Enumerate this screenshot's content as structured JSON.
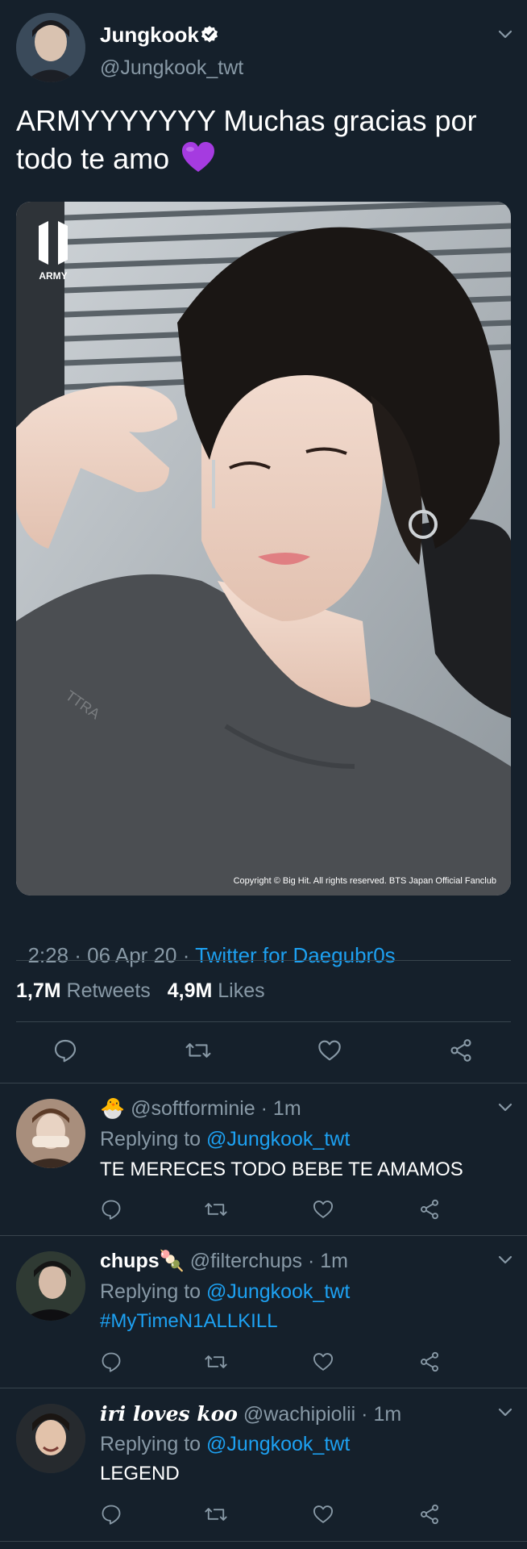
{
  "tweet": {
    "display_name": "Jungkook",
    "handle": "@Jungkook_twt",
    "text": "ARMYYYYYYY Muchas gracias por todo te amo",
    "emoji": "💜",
    "photo": {
      "logo_text": "ARMY",
      "shirt_text": "TTRA",
      "copyright": "Copyright © Big Hit. All rights reserved. BTS Japan Official Fanclub"
    },
    "time_date": "2:28 · 06 Apr 20 · ",
    "source": "Twitter for Daegubr0s",
    "retweets_count": "1,7M",
    "retweets_label": "Retweets",
    "likes_count": "4,9M",
    "likes_label": "Likes"
  },
  "replies": [
    {
      "display_name": "",
      "emoji": "🐣",
      "handle": "@softforminie",
      "time": "· 1m",
      "replying_prefix": "Replying to",
      "replying_to": "@Jungkook_twt",
      "text": "TE MERECES TODO BEBE TE AMAMOS"
    },
    {
      "display_name": "chups",
      "emoji": "🍡",
      "handle": "@filterchups",
      "time": "· 1m",
      "replying_prefix": "Replying to",
      "replying_to": "@Jungkook_twt",
      "text": "#MyTimeN1ALLKILL"
    },
    {
      "display_name": "iri loves koo",
      "emoji": "",
      "handle": "@wachipiolii",
      "time": "· 1m",
      "replying_prefix": "Replying to",
      "replying_to": "@Jungkook_twt",
      "text": "LEGEND"
    }
  ],
  "icons": [
    "verified-badge-icon",
    "chevron-down-icon",
    "reply-icon",
    "retweet-icon",
    "like-icon",
    "share-icon"
  ],
  "colors": {
    "background": "#15202b",
    "accent": "#1da1f2",
    "secondary_text": "#8899a6",
    "divider": "#38444d",
    "purple_heart": "#a53be0"
  }
}
